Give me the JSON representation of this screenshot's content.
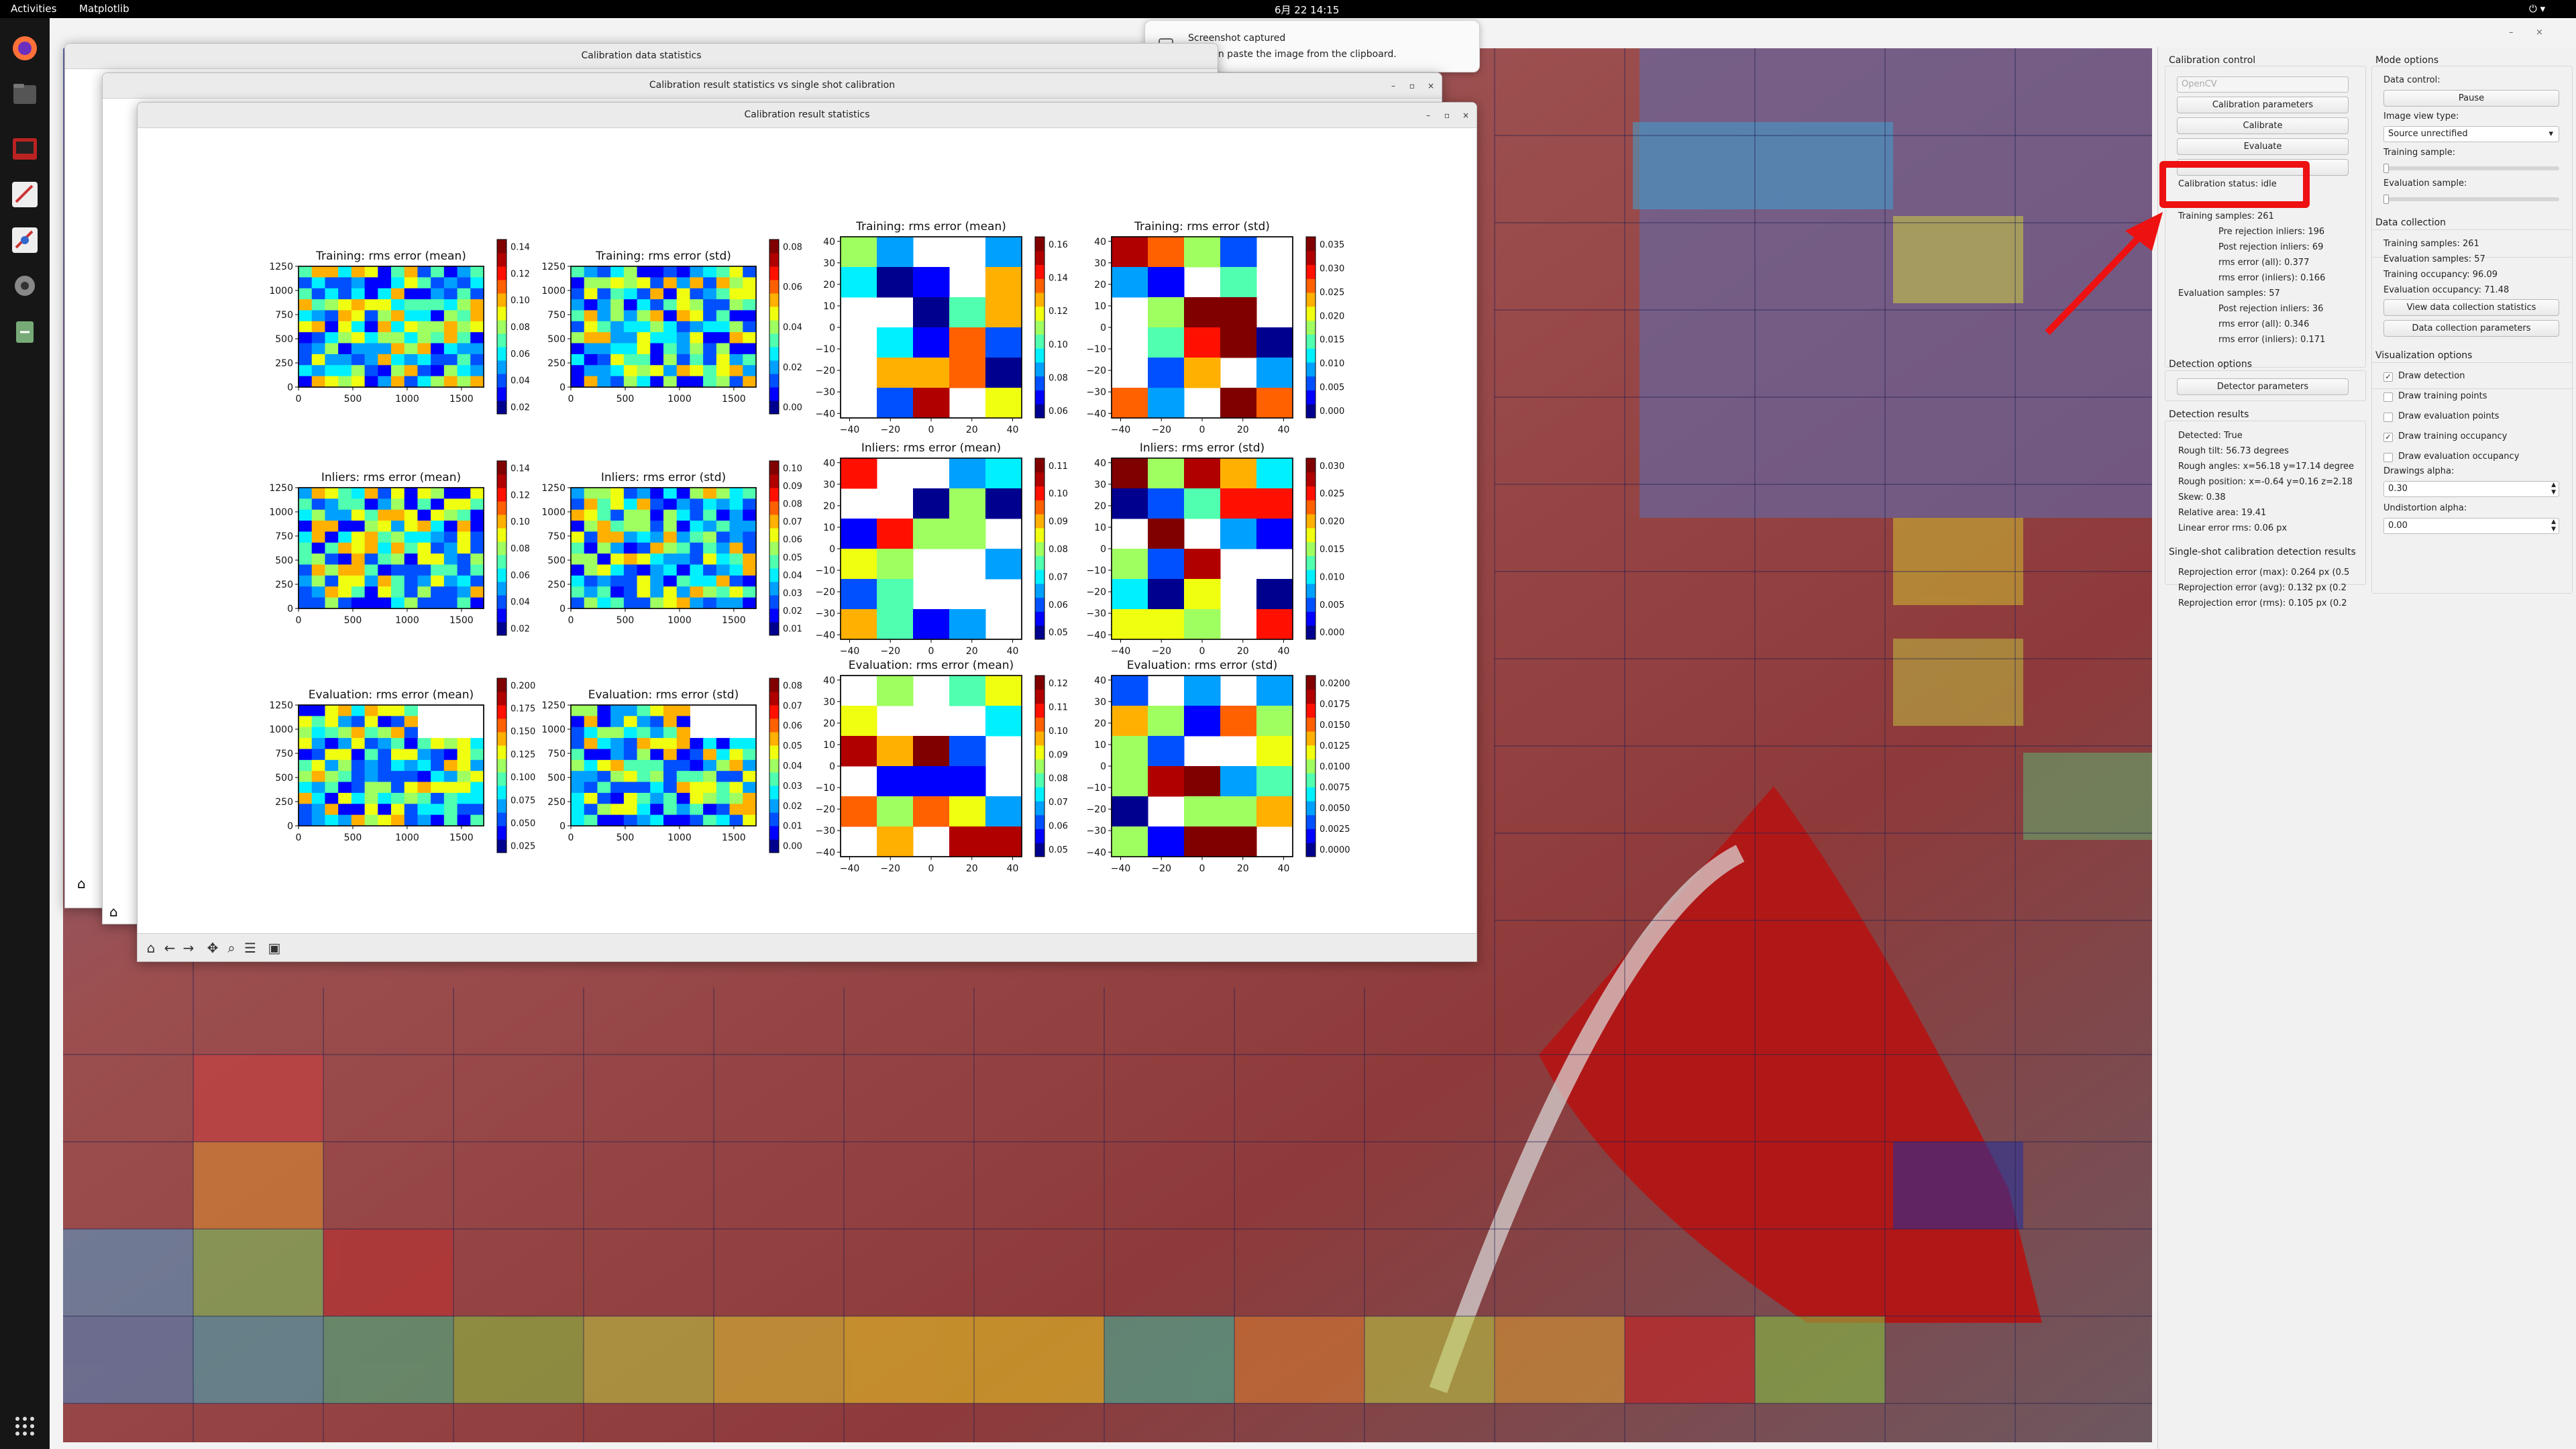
{
  "topbar": {
    "activities": "Activities",
    "app_name": "Matplotlib",
    "datetime": "6月 22  14:15"
  },
  "notification": {
    "title": "Screenshot captured",
    "body": "You can paste the image from the clipboard."
  },
  "windows": {
    "back": {
      "title": "Calibration data statistics"
    },
    "middle": {
      "title": "Calibration result statistics vs single shot calibration"
    },
    "front": {
      "title": "Calibration result statistics"
    }
  },
  "figure": {
    "panels": [
      {
        "title": "Training: rms error (mean)",
        "yticks": [
          "1250",
          "1000",
          "750",
          "500",
          "250",
          "0"
        ],
        "xticks": [
          "0",
          "500",
          "1000",
          "1500"
        ],
        "cticks": [
          "0.14",
          "0.12",
          "0.10",
          "0.08",
          "0.06",
          "0.04",
          "0.02"
        ]
      },
      {
        "title": "Training: rms error (std)",
        "yticks": [
          "1250",
          "1000",
          "750",
          "500",
          "250",
          "0"
        ],
        "xticks": [
          "0",
          "500",
          "1000",
          "1500"
        ],
        "cticks": [
          "0.08",
          "0.06",
          "0.04",
          "0.02",
          "0.00"
        ]
      },
      {
        "title": "Training: rms error (mean)",
        "yticks": [
          "40",
          "30",
          "20",
          "10",
          "0",
          "−10",
          "−20",
          "−30",
          "−40"
        ],
        "xticks": [
          "−40",
          "−20",
          "0",
          "20",
          "40"
        ],
        "cticks": [
          "0.16",
          "0.14",
          "0.12",
          "0.10",
          "0.08",
          "0.06"
        ]
      },
      {
        "title": "Training: rms error (std)",
        "yticks": [
          "40",
          "30",
          "20",
          "10",
          "0",
          "−10",
          "−20",
          "−30",
          "−40"
        ],
        "xticks": [
          "−40",
          "−20",
          "0",
          "20",
          "40"
        ],
        "cticks": [
          "0.035",
          "0.030",
          "0.025",
          "0.020",
          "0.015",
          "0.010",
          "0.005",
          "0.000"
        ]
      },
      {
        "title": "Inliers: rms error (mean)",
        "yticks": [
          "1250",
          "1000",
          "750",
          "500",
          "250",
          "0"
        ],
        "xticks": [
          "0",
          "500",
          "1000",
          "1500"
        ],
        "cticks": [
          "0.14",
          "0.12",
          "0.10",
          "0.08",
          "0.06",
          "0.04",
          "0.02"
        ]
      },
      {
        "title": "Inliers: rms error (std)",
        "yticks": [
          "1250",
          "1000",
          "750",
          "500",
          "250",
          "0"
        ],
        "xticks": [
          "0",
          "500",
          "1000",
          "1500"
        ],
        "cticks": [
          "0.10",
          "0.09",
          "0.08",
          "0.07",
          "0.06",
          "0.05",
          "0.04",
          "0.03",
          "0.02",
          "0.01"
        ]
      },
      {
        "title": "Inliers: rms error (mean)",
        "yticks": [
          "40",
          "30",
          "20",
          "10",
          "0",
          "−10",
          "−20",
          "−30",
          "−40"
        ],
        "xticks": [
          "−40",
          "−20",
          "0",
          "20",
          "40"
        ],
        "cticks": [
          "0.11",
          "0.10",
          "0.09",
          "0.08",
          "0.07",
          "0.06",
          "0.05"
        ]
      },
      {
        "title": "Inliers: rms error (std)",
        "yticks": [
          "40",
          "30",
          "20",
          "10",
          "0",
          "−10",
          "−20",
          "−30",
          "−40"
        ],
        "xticks": [
          "−40",
          "−20",
          "0",
          "20",
          "40"
        ],
        "cticks": [
          "0.030",
          "0.025",
          "0.020",
          "0.015",
          "0.010",
          "0.005",
          "0.000"
        ]
      },
      {
        "title": "Evaluation: rms error (mean)",
        "yticks": [
          "1250",
          "1000",
          "750",
          "500",
          "250",
          "0"
        ],
        "xticks": [
          "0",
          "500",
          "1000",
          "1500"
        ],
        "cticks": [
          "0.200",
          "0.175",
          "0.150",
          "0.125",
          "0.100",
          "0.075",
          "0.050",
          "0.025"
        ]
      },
      {
        "title": "Evaluation: rms error (std)",
        "yticks": [
          "1250",
          "1000",
          "750",
          "500",
          "250",
          "0"
        ],
        "xticks": [
          "0",
          "500",
          "1000",
          "1500"
        ],
        "cticks": [
          "0.08",
          "0.07",
          "0.06",
          "0.05",
          "0.04",
          "0.03",
          "0.02",
          "0.01",
          "0.00"
        ]
      },
      {
        "title": "Evaluation: rms error (mean)",
        "yticks": [
          "40",
          "30",
          "20",
          "10",
          "0",
          "−10",
          "−20",
          "−30",
          "−40"
        ],
        "xticks": [
          "−40",
          "−20",
          "0",
          "20",
          "40"
        ],
        "cticks": [
          "0.12",
          "0.11",
          "0.10",
          "0.09",
          "0.08",
          "0.07",
          "0.06",
          "0.05"
        ]
      },
      {
        "title": "Evaluation: rms error (std)",
        "yticks": [
          "40",
          "30",
          "20",
          "10",
          "0",
          "−10",
          "−20",
          "−30",
          "−40"
        ],
        "xticks": [
          "−40",
          "−20",
          "0",
          "20",
          "40"
        ],
        "cticks": [
          "0.0200",
          "0.0175",
          "0.0150",
          "0.0125",
          "0.0100",
          "0.0075",
          "0.0050",
          "0.0025",
          "0.0000"
        ]
      }
    ]
  },
  "control": {
    "title": "Calibration control",
    "backend_value": "OpenCV",
    "btn_params": "Calibration parameters",
    "btn_calibrate": "Calibrate",
    "btn_evaluate": "Evaluate",
    "status": "Calibration status: idle",
    "stats": [
      "Training samples: 261",
      "Pre rejection inliers: 196",
      "Post rejection inliers: 69",
      "rms error (all): 0.377",
      "rms error (inliers): 0.166",
      "Evaluation samples: 57",
      "Post rejection inliers: 36",
      "rms error (all): 0.346",
      "rms error (inliers): 0.171"
    ]
  },
  "detection": {
    "title": "Detection options",
    "btn_params": "Detector parameters"
  },
  "detection_results": {
    "title": "Detection results",
    "lines": [
      "Detected: True",
      "Rough tilt: 56.73 degrees",
      "Rough angles: x=56.18 y=17.14 degree",
      "Rough position: x=-0.64 y=0.16 z=2.18",
      "Skew: 0.38",
      "Relative area: 19.41",
      "Linear error rms: 0.06 px"
    ]
  },
  "single_shot": {
    "title": "Single-shot calibration detection results",
    "lines": [
      "Reprojection error (max): 0.264 px (0.5",
      "Reprojection error (avg): 0.132 px (0.2",
      "Reprojection error (rms): 0.105 px (0.2"
    ]
  },
  "mode": {
    "title": "Mode options",
    "data_control_label": "Data control:",
    "pause": "Pause",
    "view_type_label": "Image view type:",
    "view_type_value": "Source unrectified",
    "training_sample_label": "Training sample:",
    "evaluation_sample_label": "Evaluation sample:"
  },
  "data_collection": {
    "title": "Data collection",
    "lines": [
      "Training samples: 261",
      "Evaluation samples: 57",
      "Training occupancy: 96.09",
      "Evaluation occupancy: 71.48"
    ],
    "btn_stats": "View data collection statistics",
    "btn_params": "Data collection parameters"
  },
  "visualization": {
    "title": "Visualization options",
    "checks": [
      {
        "label": "Draw detection",
        "checked": true
      },
      {
        "label": "Draw training points",
        "checked": false
      },
      {
        "label": "Draw evaluation points",
        "checked": false
      },
      {
        "label": "Draw training occupancy",
        "checked": true
      },
      {
        "label": "Draw evaluation occupancy",
        "checked": false
      }
    ],
    "alpha_label": "Drawings alpha:",
    "alpha_value": "0.30",
    "undist_label": "Undistortion alpha:",
    "undist_value": "0.00"
  },
  "colors": {
    "highlight": "#ee1111",
    "arrow": "#ee1111"
  }
}
